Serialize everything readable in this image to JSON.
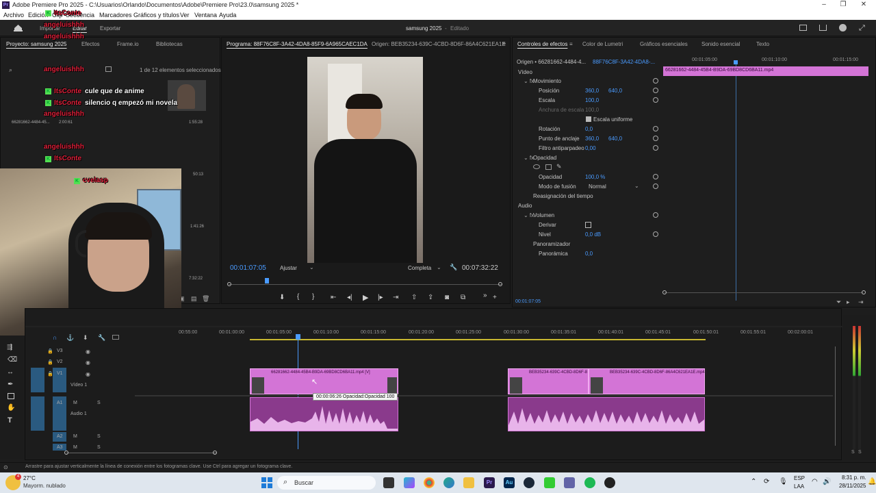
{
  "window": {
    "title": "Adobe Premiere Pro 2025 - C:\\Usuarios\\Orlando\\Documentos\\Adobe\\Premiere Pro\\23.0\\samsung 2025 *",
    "logo": "Pr"
  },
  "menu": [
    "Archivo",
    "Edición",
    "Clip",
    "Secuencia",
    "Marcadores",
    "Gráficos y títulos",
    "Ver",
    "Ventana",
    "Ayuda"
  ],
  "workspace": {
    "tabs": [
      "Importar",
      "Editar",
      "Exportar"
    ],
    "project_title": "samsung 2025",
    "status": "Editado"
  },
  "project_panel": {
    "tabs": [
      "Proyecto: samsung 2025",
      "Efectos",
      "Frame.io",
      "Bibliotecas"
    ],
    "selection_count": "1 de 12 elementos seleccionados",
    "items": [
      {
        "name": "66281662-4484-45...",
        "duration": "2:00:61"
      },
      {
        "duration": "1:55:28"
      },
      {
        "duration": "50:13"
      },
      {
        "duration": "1:41:26"
      },
      {
        "duration": "7:32:22"
      }
    ]
  },
  "program_monitor": {
    "tab_label": "Programa: 88F76C8F-3A42-4DA8-85F9-6A965CAEC1DA",
    "origin_label": "Origen: BEB35234-639C-4CBD-8D6F-86A4C621EA1E",
    "timecode_current": "00:01:07:05",
    "fit": "Ajustar",
    "quality": "Completa",
    "timecode_total": "00:07:32:22"
  },
  "effect_controls": {
    "tabs": [
      "Controles de efectos",
      "Color de Lumetri",
      "Gráficos esenciales",
      "Sonido esencial",
      "Texto"
    ],
    "source_label": "Origen • 66281662-4484-4...",
    "clip_label": "88F76C8F-3A42-4DA8-...",
    "ruler": [
      "00:01:05:00",
      "00:01:10:00",
      "00:01:15:00"
    ],
    "clip_bar": "66281662-4484-45B4-B9DA-69BD8CD6BA11.mp4",
    "video_label": "Vídeo",
    "movimiento": "Movimiento",
    "posicion_label": "Posición",
    "posicion_x": "360,0",
    "posicion_y": "640,0",
    "escala_label": "Escala",
    "escala": "100,0",
    "anchura_label": "Anchura de escala",
    "anchura": "100,0",
    "escala_uniforme": "Escala uniforme",
    "rotacion_label": "Rotación",
    "rotacion": "0,0",
    "anclaje_label": "Punto de anclaje",
    "anclaje_x": "360,0",
    "anclaje_y": "640,0",
    "filtro_label": "Filtro antiparpadeo",
    "filtro": "0,00",
    "opacidad_group": "Opacidad",
    "opacidad_label": "Opacidad",
    "opacidad": "100,0 %",
    "fusion_label": "Modo de fusión",
    "fusion": "Normal",
    "reasignacion": "Reasignación del tiempo",
    "audio_label": "Audio",
    "volumen": "Volumen",
    "derivar_label": "Derivar",
    "nivel_label": "Nivel",
    "nivel": "0,0 dB",
    "panoramizador": "Panoramizador",
    "panoramica_label": "Panorámica",
    "panoramica": "0,0",
    "footer_timecode": "00:01:07:05"
  },
  "timeline": {
    "ruler": [
      "00:55:00",
      "00:01:00:00",
      "00:01:05:00",
      "00:01:10:00",
      "00:01:15:00",
      "00:01:20:00",
      "00:01:25:00",
      "00:01:30:00",
      "00:01:35:01",
      "00:01:40:01",
      "00:01:45:01",
      "00:01:50:01",
      "00:01:55:01",
      "00:02:00:01"
    ],
    "tracks_video": [
      "V3",
      "V2",
      "V1"
    ],
    "video1_name": "Vídeo 1",
    "tracks_audio": [
      "A1",
      "A2",
      "A3"
    ],
    "audio1_name": "Audio 1",
    "clip1": "66281662-4484-45B4-B9DA-69BD8CD6BA11.mp4 [V]",
    "clip2": "BEB35234-639C-4CBD-8D6F-8",
    "clip3": "BEB35234-639C-4CBD-8D6F-86A4C621EA1E.mp4 [",
    "tooltip": "00:00:06:26  Opacidad:Opacidad  100",
    "meter_labels": [
      "S",
      "S"
    ]
  },
  "status_bar": "Arrastre para ajustar verticalmente la línea de conexión entre los fotogramas clave. Use Ctrl para agregar un fotograma clave.",
  "chat": [
    {
      "name": "ItsConte",
      "msg": ""
    },
    {
      "name": "angeluishhh",
      "msg": ""
    },
    {
      "name": "angeluishhh",
      "msg": ""
    },
    {
      "name": "angeluishhh",
      "msg": ""
    },
    {
      "name": "ItsConte",
      "msg": "cule que de anime"
    },
    {
      "name": "ItsConte",
      "msg": "silencio q empezó mi novela"
    },
    {
      "name": "angeluishhh",
      "msg": ""
    },
    {
      "name": "angeluishhh",
      "msg": ""
    },
    {
      "name": "ItsConte",
      "msg": ""
    },
    {
      "name": "cvelasp",
      "msg": ""
    }
  ],
  "taskbar": {
    "weather_temp": "27°C",
    "weather_desc": "Mayorm. nublado",
    "weather_badge": "4",
    "search": "Buscar",
    "lang1": "ESP",
    "lang2": "LAA",
    "time": "8:31 p. m.",
    "date": "28/11/2025"
  },
  "colors": {
    "clip_pink": "#d374d6",
    "timecode_blue": "#4a9bff",
    "chat_red": "#e0203a",
    "kick_green": "#52e052"
  }
}
